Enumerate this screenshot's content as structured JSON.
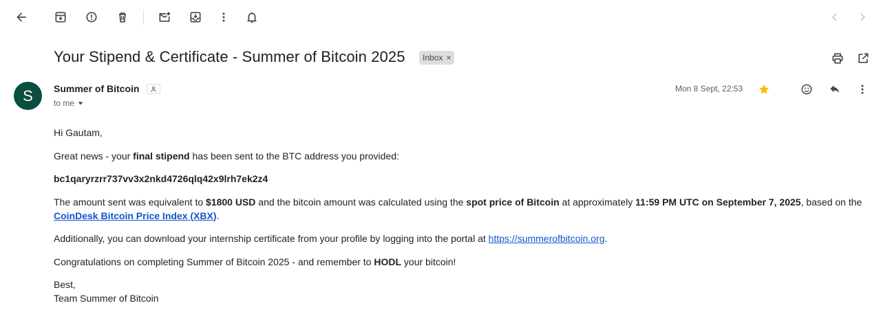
{
  "toolbar": {
    "back_icon": "arrow-left-icon",
    "archive_icon": "archive-icon",
    "spam_icon": "report-spam-icon",
    "delete_icon": "trash-icon",
    "unread_icon": "mark-unread-icon",
    "move_icon": "move-to-icon",
    "more_icon": "more-vertical-icon",
    "snooze_icon": "bell-icon",
    "prev_icon": "chevron-left-icon",
    "next_icon": "chevron-right-icon"
  },
  "message": {
    "subject": "Your Stipend & Certificate - Summer of Bitcoin 2025",
    "label_chip": "Inbox",
    "label_remove": "×",
    "avatar_letter": "S",
    "avatar_color": "#0b4d3e",
    "sender_name": "Summer of Bitcoin",
    "recipient": "to me",
    "date": "Mon 8 Sept, 22:53",
    "starred": true,
    "star_color": "#fbbc04"
  },
  "body": {
    "greeting": "Hi Gautam,",
    "p1_a": "Great news - your ",
    "p1_bold": "final stipend",
    "p1_b": " has been sent to the BTC address you provided:",
    "btc_address": "bc1qaryrzrr737vv3x2nkd4726qlq42x9lrh7ek2z4",
    "p2_a": "The amount sent was equivalent to ",
    "p2_amount": "$1800 USD",
    "p2_b": " and the bitcoin amount was calculated using the ",
    "p2_spot": "spot price of Bitcoin",
    "p2_c": " at approximately ",
    "p2_time": "11:59 PM UTC on September 7, 2025",
    "p2_d": ", based on the ",
    "p2_link": "CoinDesk Bitcoin Price Index (XBX)",
    "p2_e": ".",
    "p3_a": "Additionally, you can download your internship certificate from your profile by logging into the portal at ",
    "p3_link": "https://summerofbitcoin.org",
    "p3_b": ".",
    "p4_a": "Congratulations on completing Summer of Bitcoin 2025 - and remember to ",
    "p4_bold": "HODL",
    "p4_b": " your bitcoin!",
    "signoff": "Best,",
    "signature": "Team Summer of Bitcoin"
  }
}
